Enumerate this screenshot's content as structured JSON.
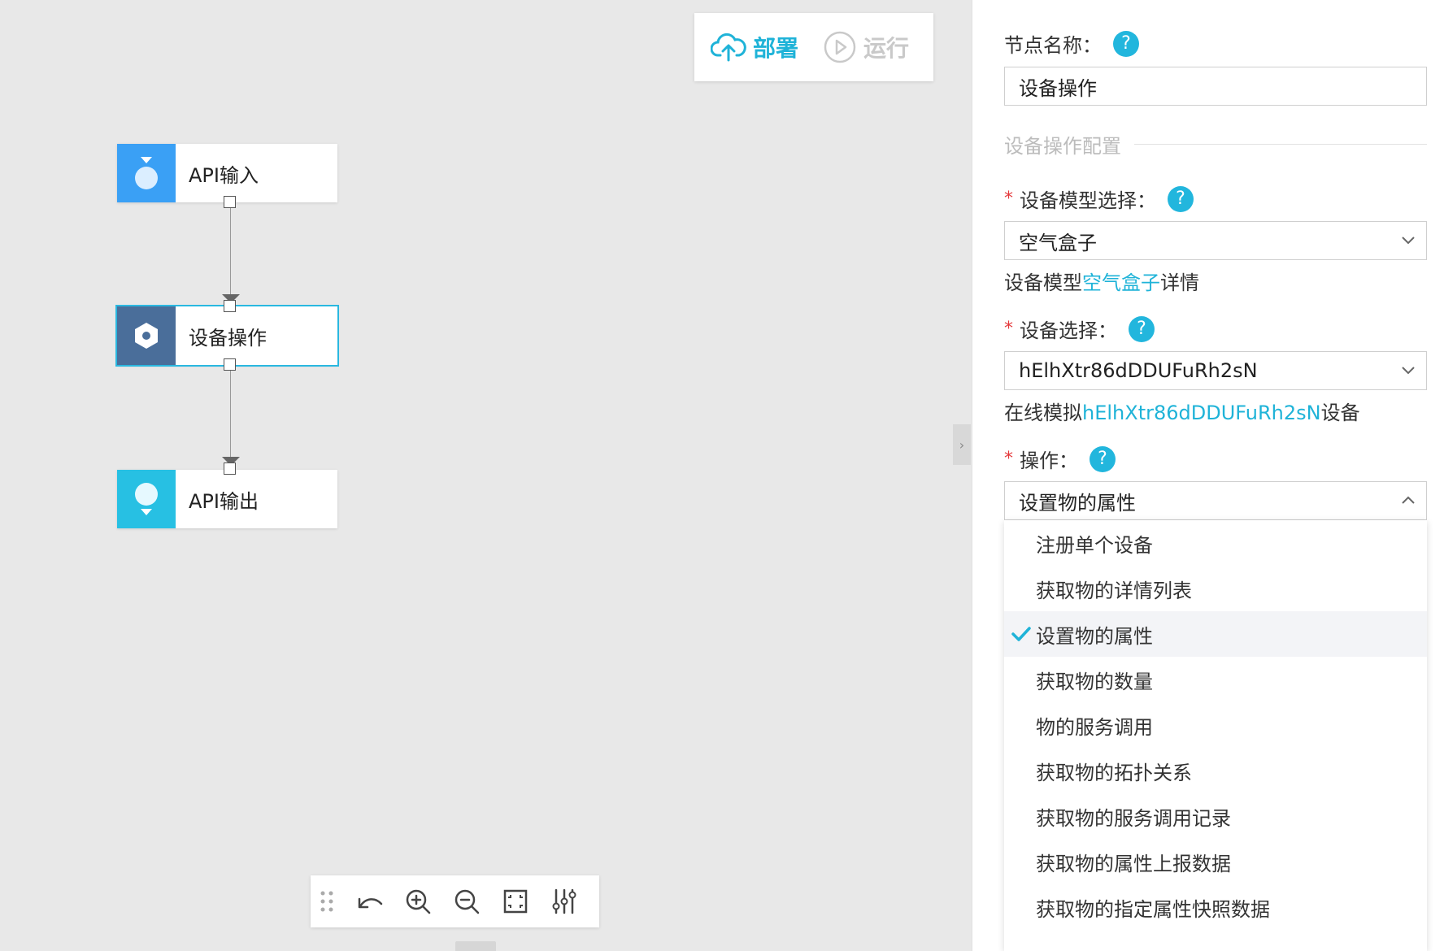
{
  "toolbar": {
    "deploy_label": "部署",
    "run_label": "运行"
  },
  "nodes": [
    {
      "label": "API输入",
      "icon": "api-input-icon",
      "color": "#3aa0f5"
    },
    {
      "label": "设备操作",
      "icon": "device-operation-icon",
      "color": "#4a6e9a"
    },
    {
      "label": "API输出",
      "icon": "api-output-icon",
      "color": "#27c0e3"
    }
  ],
  "panel": {
    "node_name_label": "节点名称：",
    "node_name_value": "设备操作",
    "section_title": "设备操作配置",
    "model_label": "设备模型选择：",
    "model_value": "空气盒子",
    "model_hint_prefix": "设备模型",
    "model_hint_link": "空气盒子",
    "model_hint_suffix": "详情",
    "device_label": "设备选择：",
    "device_value": "hElhXtr86dDDUFuRh2sN",
    "device_hint_prefix": "在线模拟",
    "device_hint_link": "hElhXtr86dDDUFuRh2sN",
    "device_hint_suffix": "设备",
    "op_label": "操作：",
    "op_value": "设置物的属性",
    "required_mark": "*",
    "help_mark": "?"
  },
  "dropdown": {
    "selected_index": 2,
    "options": [
      "注册单个设备",
      "获取物的详情列表",
      "设置物的属性",
      "获取物的数量",
      "物的服务调用",
      "获取物的拓扑关系",
      "获取物的服务调用记录",
      "获取物的属性上报数据",
      "获取物的指定属性快照数据"
    ]
  },
  "colors": {
    "accent": "#1fb3d8",
    "required": "#e4393c",
    "help_bg": "#22b6dd"
  }
}
